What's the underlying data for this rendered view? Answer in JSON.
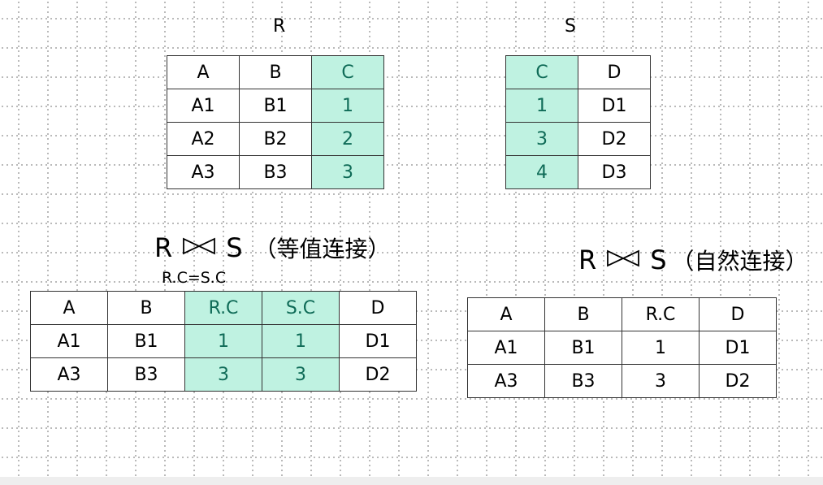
{
  "relation_r": {
    "title": "R",
    "header": [
      "A",
      "B",
      "C"
    ],
    "rows": [
      [
        "A1",
        "B1",
        "1"
      ],
      [
        "A2",
        "B2",
        "2"
      ],
      [
        "A3",
        "B3",
        "3"
      ]
    ],
    "highlight_col": 2
  },
  "relation_s": {
    "title": "S",
    "header": [
      "C",
      "D"
    ],
    "rows": [
      [
        "1",
        "D1"
      ],
      [
        "3",
        "D2"
      ],
      [
        "4",
        "D3"
      ]
    ],
    "highlight_col": 0
  },
  "equijoin": {
    "left": "R",
    "right": "S",
    "note": "（等值连接）",
    "condition": "R.C=S.C",
    "header": [
      "A",
      "B",
      "R.C",
      "S.C",
      "D"
    ],
    "rows": [
      [
        "A1",
        "B1",
        "1",
        "1",
        "D1"
      ],
      [
        "A3",
        "B3",
        "3",
        "3",
        "D2"
      ]
    ],
    "highlight_cols": [
      2,
      3
    ]
  },
  "natural_join": {
    "left": "R",
    "right": "S",
    "note": "（自然连接）",
    "header": [
      "A",
      "B",
      "R.C",
      "D"
    ],
    "rows": [
      [
        "A1",
        "B1",
        "1",
        "D1"
      ],
      [
        "A3",
        "B3",
        "3",
        "D2"
      ]
    ],
    "highlight_cols": []
  },
  "colors": {
    "highlight_fill": "#bff2e1",
    "highlight_text": "#0f6b57",
    "grid_dots": "#a8a8a8"
  },
  "icons": [
    "bowtie-join-icon"
  ]
}
